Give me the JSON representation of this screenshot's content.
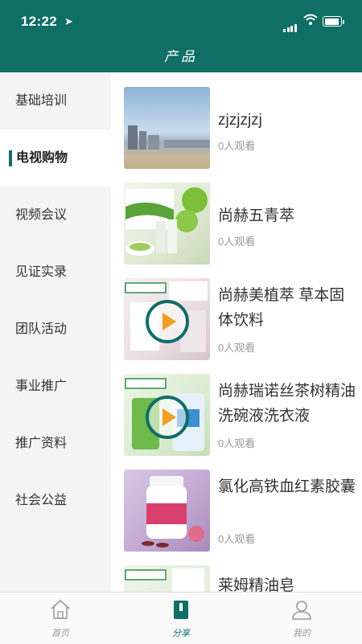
{
  "status_bar": {
    "time": "12:22"
  },
  "header": {
    "title": "产品"
  },
  "sidebar": {
    "items": [
      {
        "label": "基础培训",
        "active": false
      },
      {
        "label": "电视购物",
        "active": true
      },
      {
        "label": "视频会议",
        "active": false
      },
      {
        "label": "见证实录",
        "active": false
      },
      {
        "label": "团队活动",
        "active": false
      },
      {
        "label": "事业推广",
        "active": false
      },
      {
        "label": "推广资料",
        "active": false
      },
      {
        "label": "社会公益",
        "active": false
      }
    ]
  },
  "products": [
    {
      "title": "zjzjzjzj",
      "views": "0人观看",
      "has_play": false
    },
    {
      "title": "尚赫五青萃",
      "views": "0人观看",
      "has_play": false
    },
    {
      "title": "尚赫美植萃 草本固体饮料",
      "views": "0人观看",
      "has_play": true
    },
    {
      "title": "尚赫瑞诺丝茶树精油洗碗液洗衣液",
      "views": "0人观看",
      "has_play": true
    },
    {
      "title": "氯化高铁血红素胶囊",
      "views": "0人观看",
      "has_play": false
    },
    {
      "title": "莱姆精油皂",
      "views": "",
      "has_play": false
    }
  ],
  "tabbar": {
    "items": [
      {
        "label": "首页",
        "icon": "home-icon",
        "active": false
      },
      {
        "label": "分享",
        "icon": "share-icon",
        "active": true
      },
      {
        "label": "我的",
        "icon": "profile-icon",
        "active": false
      }
    ]
  },
  "colors": {
    "accent": "#0f6e65",
    "play": "#f0a020",
    "sidebar_bg": "#f4f4f4"
  }
}
